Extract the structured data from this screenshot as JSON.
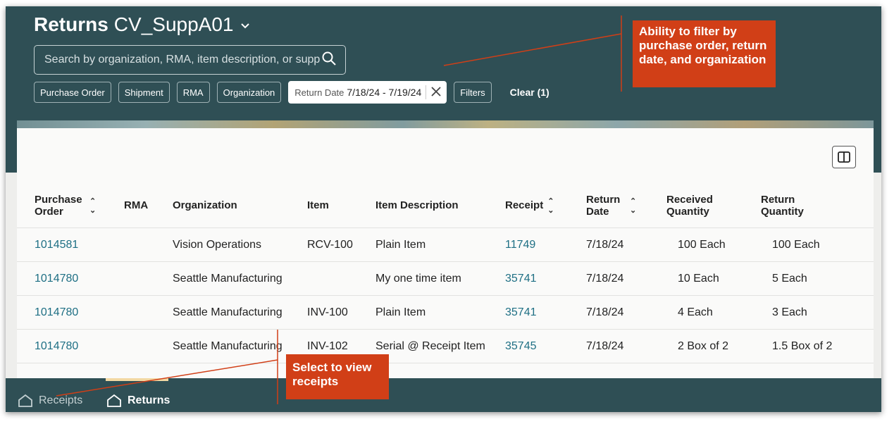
{
  "header": {
    "title": "Returns",
    "subtitle": "CV_SuppA01"
  },
  "search": {
    "placeholder": "Search by organization, RMA, item description, or supplier"
  },
  "chips": {
    "purchase_order": "Purchase Order",
    "shipment": "Shipment",
    "rma": "RMA",
    "organization": "Organization",
    "return_date_label": "Return Date",
    "return_date_value": "7/18/24 - 7/19/24",
    "filters": "Filters",
    "clear": "Clear (1)"
  },
  "table": {
    "columns": [
      "Purchase Order",
      "RMA",
      "Organization",
      "Item",
      "Item Description",
      "Receipt",
      "Return Date",
      "Received Quantity",
      "Return Quantity"
    ],
    "rows": [
      [
        "1014581",
        "",
        "Vision Operations",
        "RCV-100",
        "Plain Item",
        "11749",
        "7/18/24",
        "100 Each",
        "100 Each"
      ],
      [
        "1014780",
        "",
        "Seattle Manufacturing",
        "",
        "My one time item",
        "35741",
        "7/18/24",
        "10 Each",
        "5 Each"
      ],
      [
        "1014780",
        "",
        "Seattle Manufacturing",
        "INV-100",
        "Plain Item",
        "35741",
        "7/18/24",
        "4 Each",
        "3 Each"
      ],
      [
        "1014780",
        "",
        "Seattle Manufacturing",
        "INV-102",
        "Serial @ Receipt Item",
        "35745",
        "7/18/24",
        "2 Box of 2",
        "1.5 Box of 2"
      ]
    ]
  },
  "bottom_nav": {
    "receipts": "Receipts",
    "returns": "Returns"
  },
  "callouts": {
    "filter": "Ability to filter by purchase order, return date, and organization",
    "receipts": "Select to view receipts"
  },
  "colors": {
    "header_bg": "#2f4f55",
    "link": "#1e6f84",
    "callout": "#d13f17"
  }
}
